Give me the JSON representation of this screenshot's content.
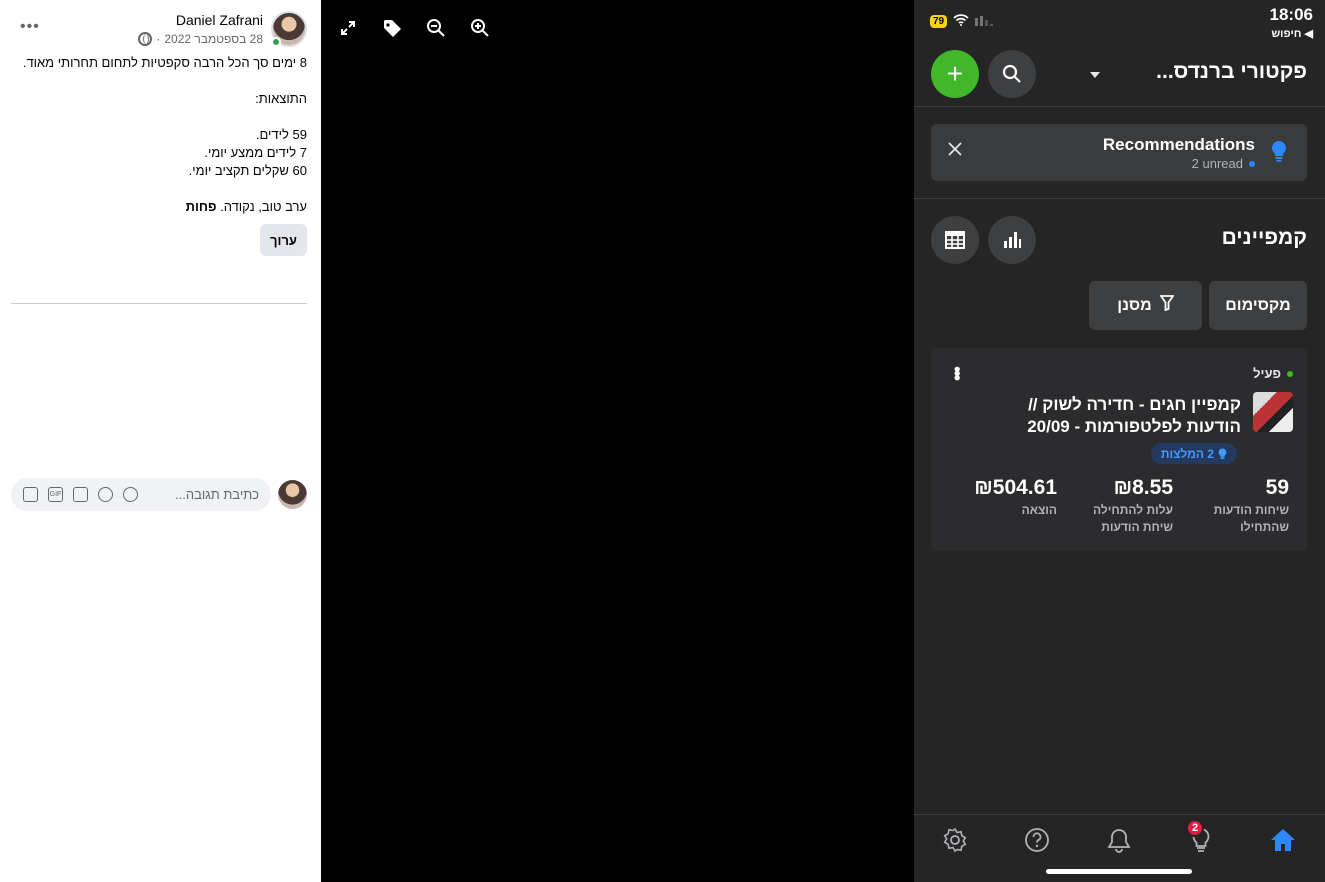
{
  "post": {
    "author": "Daniel Zafrani",
    "date": "28 בספטמבר 2022",
    "separator": "·",
    "more": "•••",
    "lines": [
      "8 ימים סך הכל הרבה סקפטיות לתחום תחרותי מאוד.",
      "",
      "התוצאות:",
      "",
      "59 לידים.",
      "7 לידים ממצע יומי.",
      "60 שקלים תקציב יומי.",
      "",
      "ערב טוב, נקודה. "
    ],
    "bold_tail": "פחות",
    "edit_label": "ערוך",
    "comment_placeholder": "כתיבת תגובה...",
    "comment_icons": [
      "avatar-sticker-icon",
      "gif-icon",
      "camera-icon",
      "emoji-icon",
      "sticker-icon"
    ],
    "gif_text": "GIF"
  },
  "viewer": {
    "tools": [
      "expand-icon",
      "tag-icon",
      "zoom-out-icon",
      "zoom-in-icon"
    ]
  },
  "phone": {
    "status": {
      "time": "18:06",
      "back": "◀ חיפוש",
      "battery": "79"
    },
    "account_title": "פקטורי ברנדס...",
    "add_symbol": "+",
    "recommendations": {
      "title": "Recommendations",
      "unread": "2 unread"
    },
    "campaigns_title": "קמפיינים",
    "max_label": "מקסימום",
    "filter_label": "מסנן",
    "campaign": {
      "status": "פעיל",
      "name": "קמפיין חגים - חדירה לשוק // הודעות לפלטפורמות - 20/09",
      "reco_chip": "2 המלצות",
      "metrics": [
        {
          "value": "59",
          "label1": "שיחות הודעות",
          "label2": "שהתחילו"
        },
        {
          "value": "₪8.55",
          "label1": "עלות להתחילה",
          "label2": "שיחת הודעות"
        },
        {
          "value": "₪504.61",
          "label1": "הוצאה",
          "label2": ""
        }
      ]
    },
    "nav": {
      "items": [
        "home-icon",
        "bulb-icon",
        "bell-icon",
        "help-icon",
        "settings-icon"
      ],
      "badge": "2"
    },
    "accent": "#2d88ff",
    "green": "#42b72a"
  }
}
